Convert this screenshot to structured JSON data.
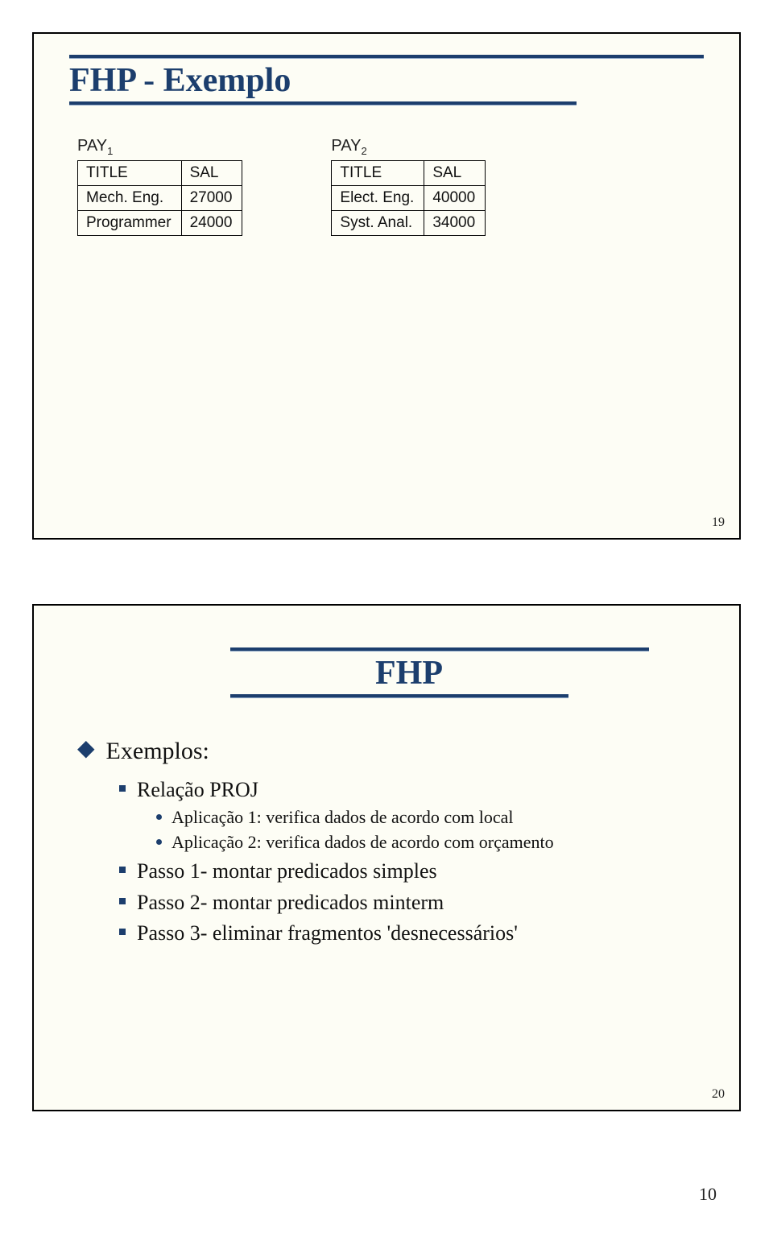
{
  "slide1": {
    "title": "FHP - Exemplo",
    "tables": [
      {
        "name_base": "PAY",
        "name_sub": "1",
        "headers": [
          "TITLE",
          "SAL"
        ],
        "rows": [
          [
            "Mech. Eng.",
            "27000"
          ],
          [
            "Programmer",
            "24000"
          ]
        ]
      },
      {
        "name_base": "PAY",
        "name_sub": "2",
        "headers": [
          "TITLE",
          "SAL"
        ],
        "rows": [
          [
            "Elect. Eng.",
            "40000"
          ],
          [
            "Syst. Anal.",
            "34000"
          ]
        ]
      }
    ],
    "page_num": "19"
  },
  "slide2": {
    "title": "FHP",
    "bullets": {
      "level1": "Exemplos:",
      "level2a": "Relação PROJ",
      "level3a": "Aplicação 1: verifica dados de acordo com local",
      "level3b": "Aplicação 2: verifica dados de acordo com orçamento",
      "level2b": "Passo 1- montar predicados simples",
      "level2c": "Passo 2- montar predicados minterm",
      "level2d": "Passo 3- eliminar fragmentos 'desnecessários'"
    },
    "page_num": "20"
  },
  "doc_page": "10"
}
